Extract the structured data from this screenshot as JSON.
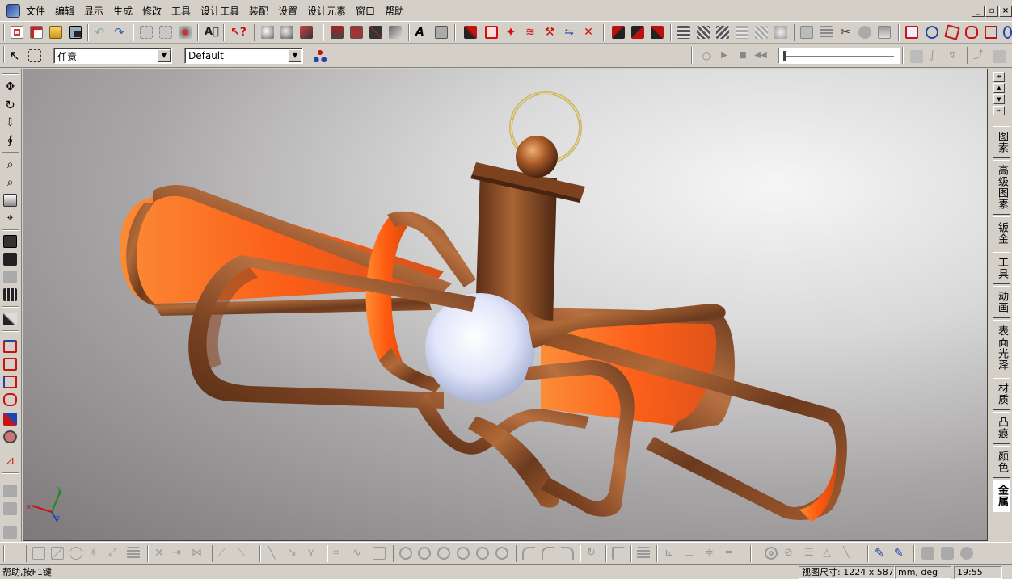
{
  "menus": [
    "文件",
    "编辑",
    "显示",
    "生成",
    "修改",
    "工具",
    "设计工具",
    "装配",
    "设置",
    "设计元素",
    "窗口",
    "帮助"
  ],
  "window_controls": {
    "minimize": "_",
    "restore": "▫",
    "close": "×"
  },
  "toolbar2": {
    "filter_select": "任意",
    "config_select": "Default"
  },
  "right_tabs": [
    "图素",
    "高级图素",
    "钣金",
    "工具",
    "动画",
    "表面光泽",
    "材质",
    "凸痕",
    "颜色",
    "金属"
  ],
  "right_tabs_active": "金属",
  "status": {
    "help_text": "帮助,按F1键",
    "view_size_label": "视图尺寸:",
    "view_width": "1224",
    "x_sep": "x",
    "view_height": "587",
    "units": "mm, deg",
    "time": "19:55"
  },
  "axes": {
    "x": "x",
    "y": "y",
    "z": "z"
  },
  "colors": {
    "chrome": "#d4d0c8",
    "wood_dark": "#6b3a1e",
    "wood_mid": "#a0592c",
    "wood_light": "#c77b45",
    "glow": "#ff6a1a",
    "ring_gold": "#c9b46a",
    "bulb": "#dfe4f8"
  }
}
